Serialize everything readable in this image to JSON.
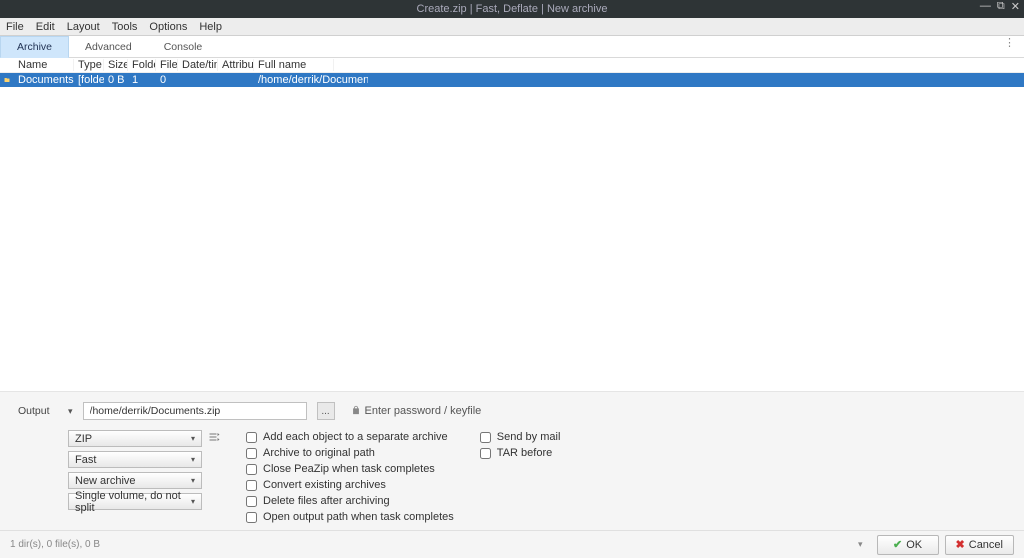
{
  "window": {
    "title": "Create.zip  |  Fast, Deflate  |  New archive"
  },
  "menu": {
    "file": "File",
    "edit": "Edit",
    "layout": "Layout",
    "tools": "Tools",
    "options": "Options",
    "help": "Help"
  },
  "tabs": {
    "archive": "Archive",
    "advanced": "Advanced",
    "console": "Console"
  },
  "table": {
    "headers": {
      "name": "Name",
      "type": "Type",
      "size": "Size",
      "folders": "Folders",
      "files": "Files",
      "datetime": "Date/time",
      "attributes": "Attributes",
      "fullname": "Full name"
    },
    "row": {
      "name": "Documents",
      "type": "[folder]",
      "size": "0 B",
      "folders": "1",
      "files": "0",
      "datetime": "",
      "attributes": "",
      "fullname": "/home/derrik/Documents"
    }
  },
  "output": {
    "label": "Output",
    "path": "/home/derrik/Documents.zip",
    "browse": "...",
    "password": "Enter password / keyfile"
  },
  "selects": {
    "format": "ZIP",
    "level": "Fast",
    "mode": "New archive",
    "split": "Single volume, do not split"
  },
  "checks": {
    "separate": "Add each object to a separate archive",
    "origpath": "Archive to original path",
    "closeapp": "Close PeaZip when task completes",
    "convert": "Convert existing archives",
    "delafter": "Delete files after archiving",
    "openout": "Open output path when task completes",
    "sendmail": "Send by mail",
    "tarbefore": "TAR before"
  },
  "footer": {
    "status": "1 dir(s), 0 file(s), 0 B",
    "ok": "OK",
    "cancel": "Cancel"
  }
}
